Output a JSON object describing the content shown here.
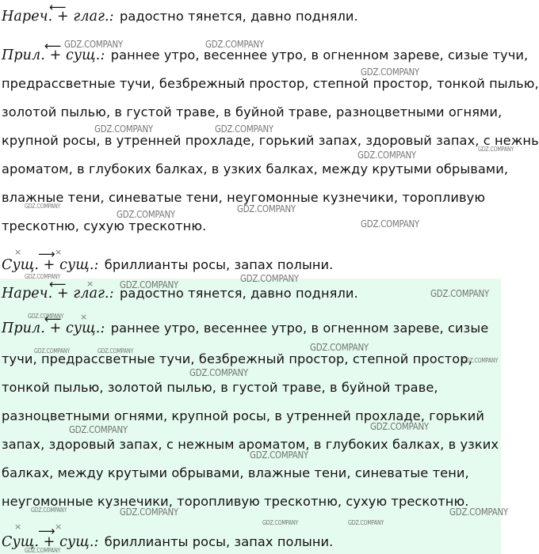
{
  "block1": {
    "adv_verb": {
      "formula": "Нареч. + глаг.:",
      "text": " радостно тянется, давно подняли."
    },
    "adj_noun": {
      "formula": "Прил. + сущ.:",
      "line1": " раннее утро, весеннее утро, в огненном зареве, сизые тучи,",
      "line2": "предрассветные тучи, безбрежный простор, степной простор, тонкой пылью,",
      "line3": "золотой пылью, в густой траве, в буйной траве, разноцветными огнями,",
      "line4": "крупной росы, в утренней прохладе, горький запах, здоровый запах, с нежным",
      "line5": "ароматом, в глубоких балках, в узких балках, между крутыми обрывами,",
      "line6": "влажные тени, синеватые тени, неугомонные кузнечики, торопливую",
      "line7": "трескотню, сухую трескотню."
    },
    "noun_noun": {
      "formula": "Сущ. + сущ.:",
      "text": " бриллианты росы, запах полыни."
    }
  },
  "block2": {
    "adv_verb": {
      "formula": "Нареч. + глаг.:",
      "text": " радостно тянется, давно подняли."
    },
    "adj_noun": {
      "formula": "Прил. + сущ.:",
      "line1": " раннее утро, весеннее утро, в огненном зареве, сизые",
      "line2": "тучи, предрассветные тучи, безбрежный простор, степной простор,",
      "line3": "тонкой пылью, золотой пылью, в густой траве, в буйной траве,",
      "line4": "разноцветными огнями, крупной росы, в утренней прохладе, горький",
      "line5": "запах, здоровый запах, с нежным ароматом, в глубоких балках, в узких",
      "line6": "балках, между крутыми обрывами, влажные тени, синеватые тени,",
      "line7": "неугомонные кузнечики, торопливую трескотню, сухую трескотню."
    },
    "noun_noun": {
      "formula": "Сущ. + сущ.:",
      "text": " бриллианты росы, запах полыни."
    }
  },
  "watermark": {
    "text": "GDZ.COMPANY"
  },
  "accent_color": "#e6fbef"
}
